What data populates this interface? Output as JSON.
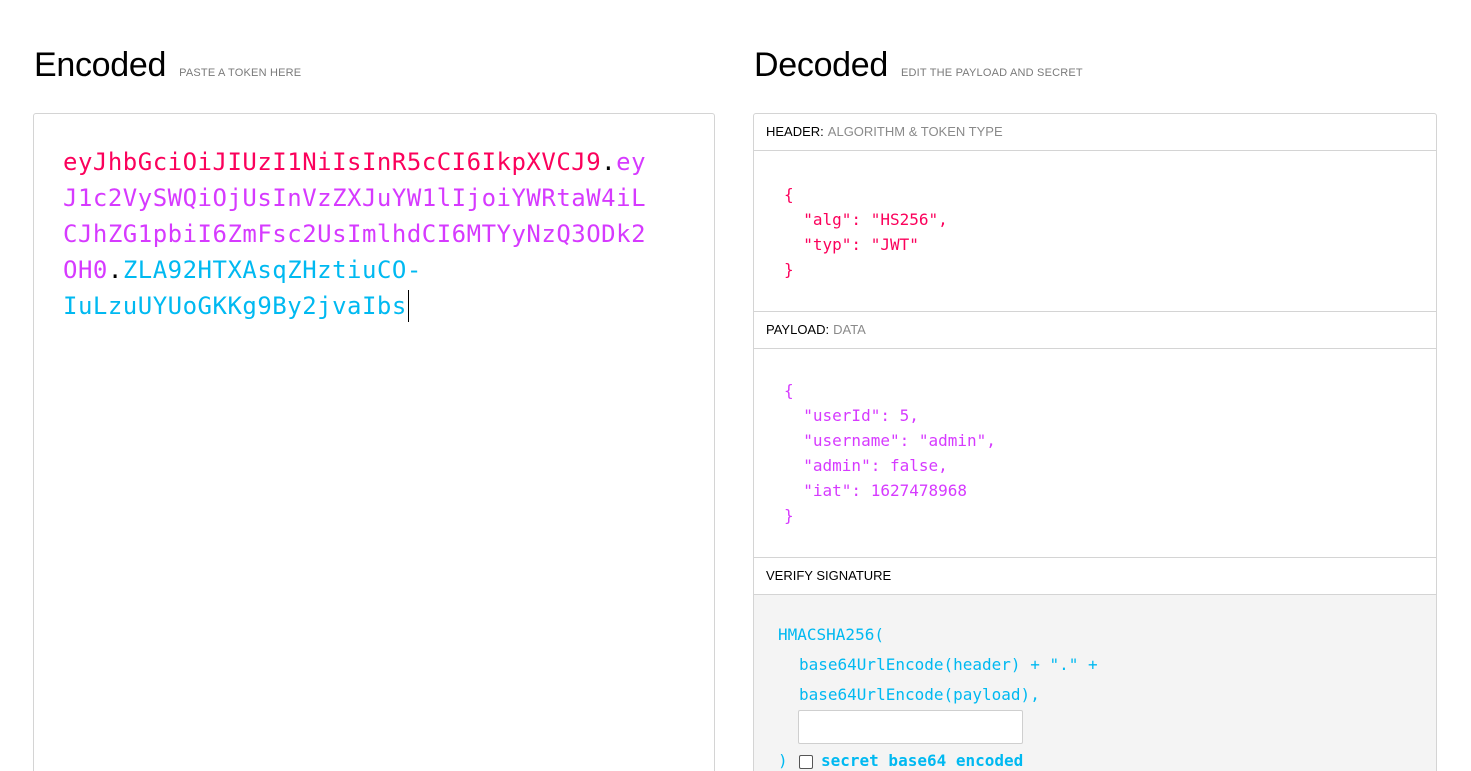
{
  "encoded": {
    "title": "Encoded",
    "subtitle": "PASTE A TOKEN HERE",
    "token_lines": [
      {
        "header": "eyJhbGciOiJIUzI1NiIsInR5cCI6IkpXVCJ9",
        "dot1": ".",
        "payload": "ey"
      },
      {
        "payload": "J1c2VySWQiOjUsInVzZXJuYW1lIjoiYWRtaW4iL"
      },
      {
        "payload": "CJhZG1pbiI6ZmFsc2UsImlhdCI6MTYyNzQ3ODk2"
      },
      {
        "payload": "OH0",
        "dot2": ".",
        "signature": "ZLA92HTXAsqZHztiuCO-"
      },
      {
        "signature": "IuLzuUYUoGKKg9By2jvaIbs"
      }
    ]
  },
  "decoded": {
    "title": "Decoded",
    "subtitle": "EDIT THE PAYLOAD AND SECRET",
    "header_panel": {
      "label": "HEADER:",
      "hint": "ALGORITHM & TOKEN TYPE",
      "json": "{\n  \"alg\": \"HS256\",\n  \"typ\": \"JWT\"\n}"
    },
    "payload_panel": {
      "label": "PAYLOAD:",
      "hint": "DATA",
      "json": "{\n  \"userId\": 5,\n  \"username\": \"admin\",\n  \"admin\": false,\n  \"iat\": 1627478968\n}"
    },
    "verify_panel": {
      "label": "VERIFY SIGNATURE",
      "fn": "HMACSHA256(",
      "line1": "base64UrlEncode(header) + \".\" +",
      "line2": "base64UrlEncode(payload),",
      "secret_value": "",
      "secret_placeholder": "",
      "close": ")",
      "checkbox_label": "secret base64 encoded",
      "checkbox_checked": false
    }
  },
  "colors": {
    "header": "#fb015b",
    "payload": "#d63aff",
    "signature": "#00b9f1"
  }
}
